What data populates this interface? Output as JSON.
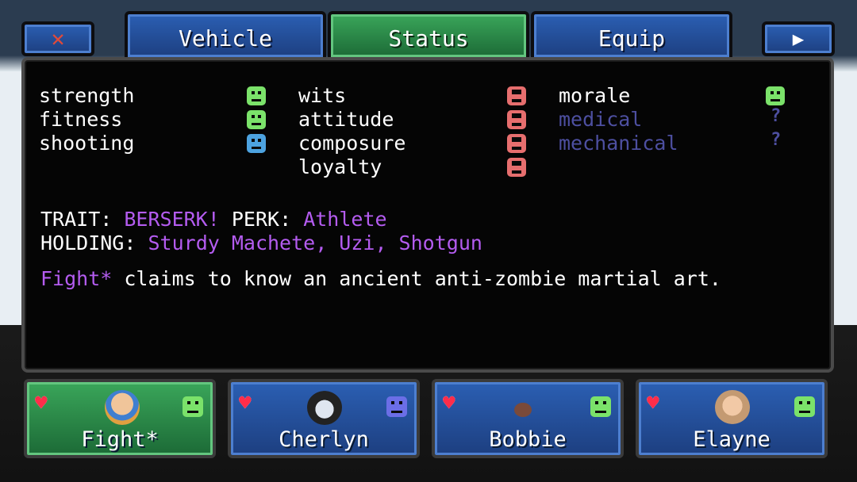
{
  "tabs": [
    {
      "label": "Vehicle"
    },
    {
      "label": "Status"
    },
    {
      "label": "Equip"
    }
  ],
  "close_icon": "close-icon",
  "next_icon": "play-arrow-icon",
  "stats": {
    "col1": [
      {
        "label": "strength",
        "mood": "happy",
        "color": "#7be26a"
      },
      {
        "label": "fitness",
        "mood": "happy",
        "color": "#7be26a"
      },
      {
        "label": "shooting",
        "mood": "neutral",
        "color": "#4da3e0"
      }
    ],
    "col2": [
      {
        "label": "wits",
        "mood": "bad",
        "color": "#e66e6e"
      },
      {
        "label": "attitude",
        "mood": "bad",
        "color": "#e66e6e"
      },
      {
        "label": "composure",
        "mood": "bad",
        "color": "#e66e6e"
      },
      {
        "label": "loyalty",
        "mood": "bad",
        "color": "#e66e6e"
      }
    ],
    "col3": [
      {
        "label": "morale",
        "mood": "happy",
        "color": "#7be26a"
      },
      {
        "label": "medical",
        "mood": "unknown",
        "mark": "?"
      },
      {
        "label": "mechanical",
        "mood": "unknown",
        "mark": "?"
      }
    ]
  },
  "trait": {
    "trait_label": "TRAIT:",
    "trait_value": "BERSERK!",
    "perk_label": "PERK:",
    "perk_value": "Athlete"
  },
  "holding": {
    "label": "HOLDING:",
    "value": "Sturdy Machete, Uzi, Shotgun"
  },
  "bio": {
    "name": "Fight*",
    "text": " claims to know an ancient anti-zombie martial art."
  },
  "party": [
    {
      "name": "Fight*",
      "mood_color": "#7be26a",
      "active": true
    },
    {
      "name": "Cherlyn",
      "mood_color": "#6b6ee6",
      "active": false
    },
    {
      "name": "Bobbie",
      "mood_color": "#7be26a",
      "active": false
    },
    {
      "name": "Elayne",
      "mood_color": "#7be26a",
      "active": false
    }
  ],
  "colors": {
    "accent_purple": "#b45cf0",
    "tab_blue": "#2b5fb3",
    "tab_green": "#3aa65a",
    "health_heart": "#ff2d4a"
  }
}
